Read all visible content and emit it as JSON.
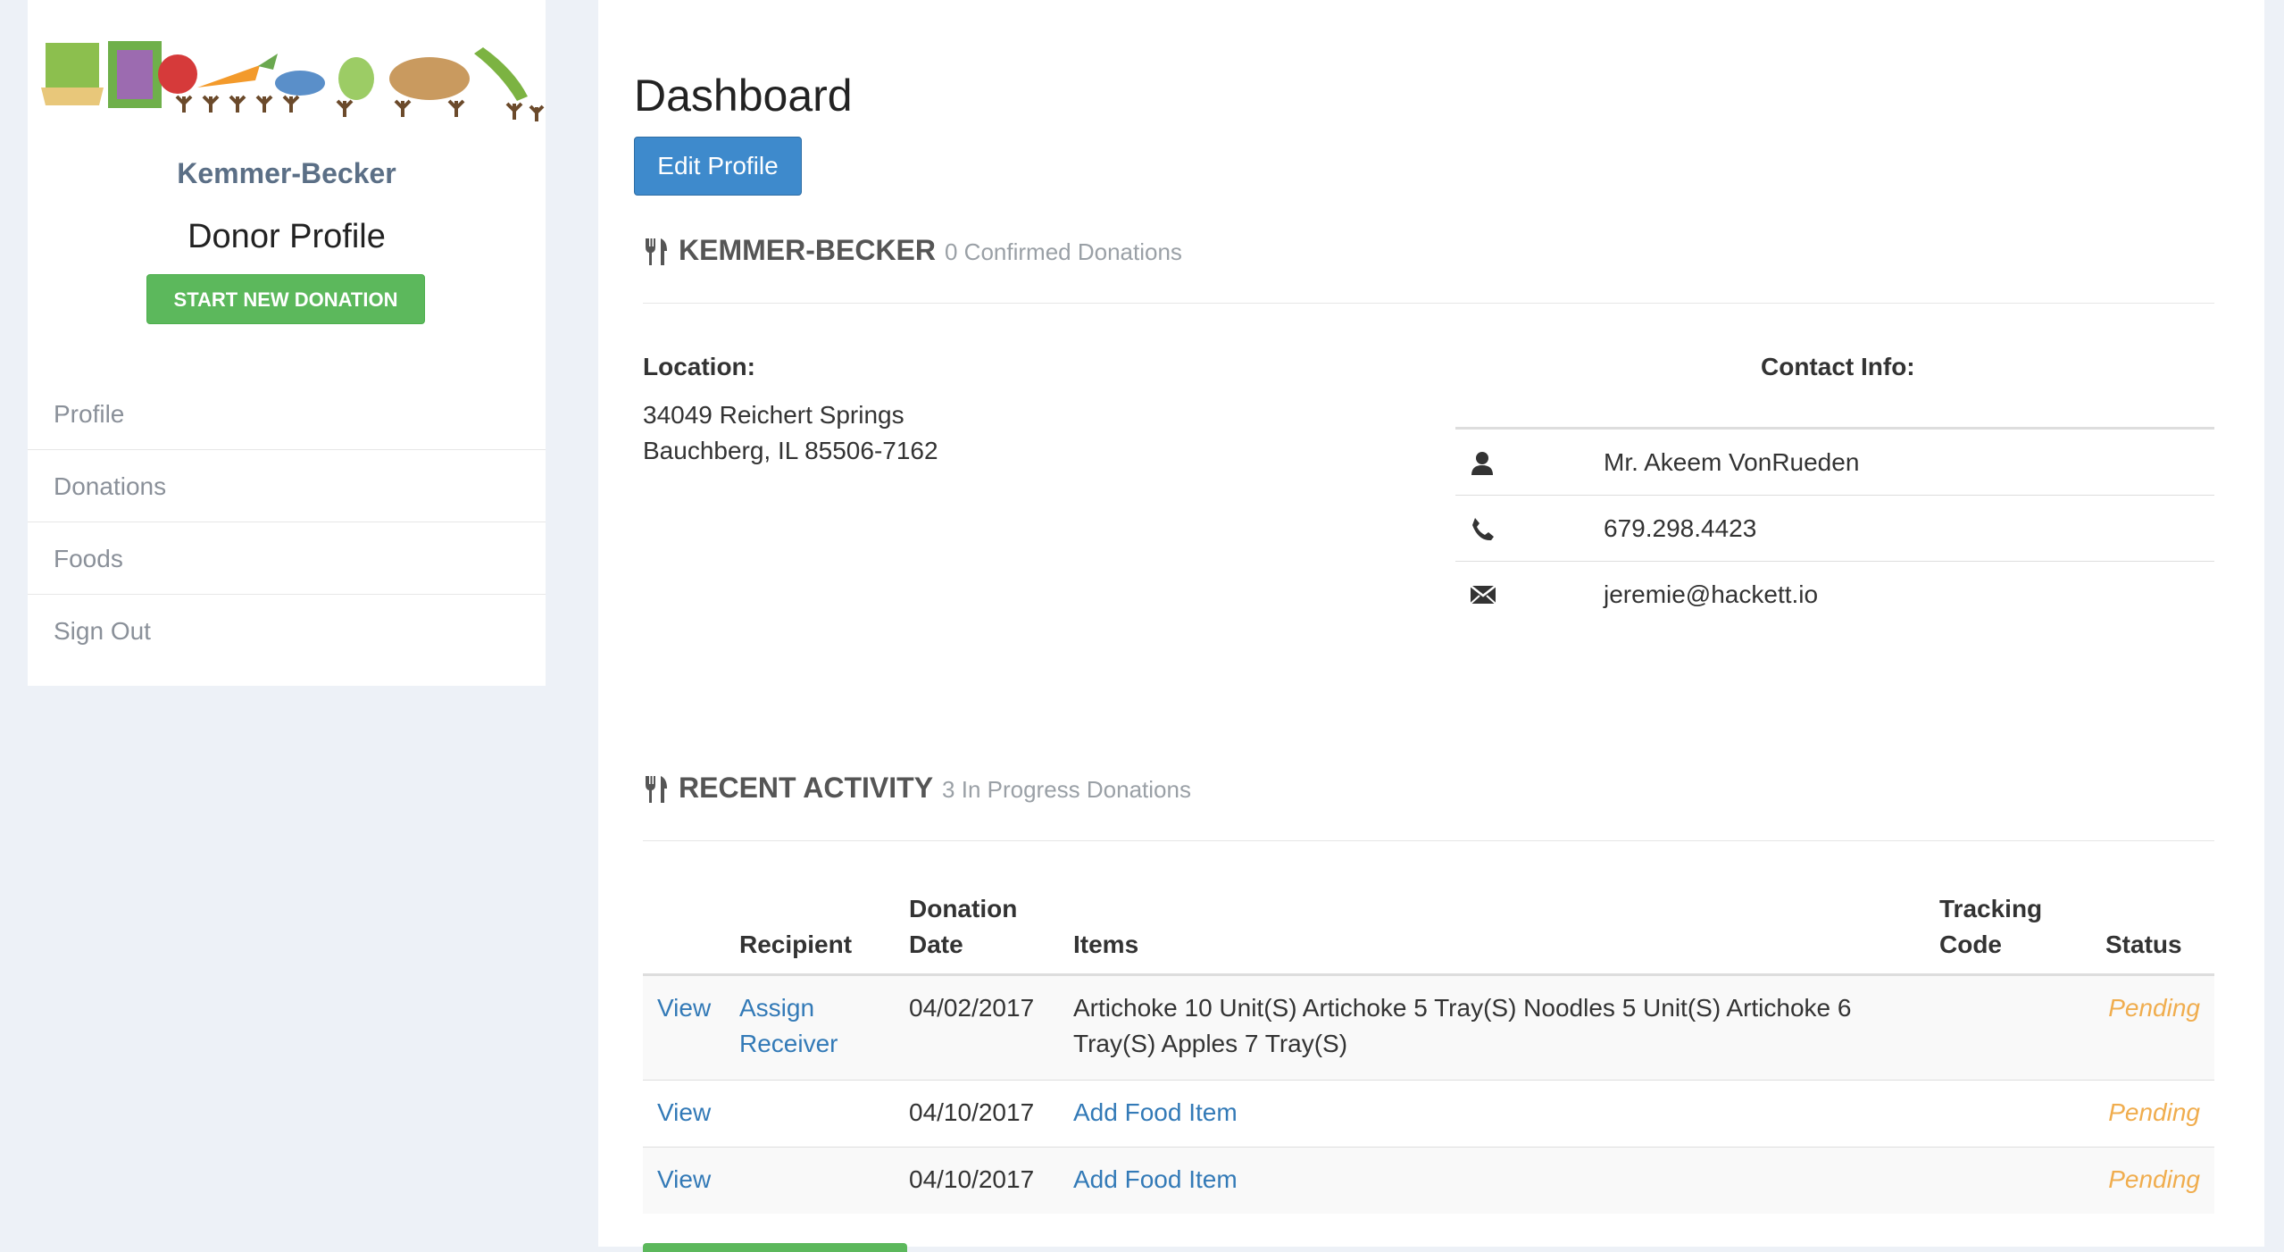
{
  "sidebar": {
    "org_name": "Kemmer-Becker",
    "profile_title": "Donor Profile",
    "start_button": "START NEW DONATION",
    "nav": [
      "Profile",
      "Donations",
      "Foods",
      "Sign Out"
    ]
  },
  "main": {
    "title": "Dashboard",
    "edit_button": "Edit Profile",
    "org_section": {
      "name": "KEMMER-BECKER",
      "sub": "0 Confirmed Donations"
    },
    "location": {
      "label": "Location:",
      "line1": "34049 Reichert Springs",
      "line2": "Bauchberg, IL 85506-7162"
    },
    "contact": {
      "label": "Contact Info:",
      "name": "Mr. Akeem VonRueden",
      "phone": "679.298.4423",
      "email": "jeremie@hackett.io",
      "icons": [
        "user-icon",
        "phone-icon",
        "envelope-icon"
      ]
    },
    "activity_section": {
      "title": "RECENT ACTIVITY",
      "sub": "3 In Progress Donations"
    },
    "table": {
      "headers": {
        "recipient": "Recipient",
        "date_1": "Donation",
        "date_2": "Date",
        "items": "Items",
        "tracking_1": "Tracking",
        "tracking_2": "Code",
        "status": "Status"
      },
      "rows": [
        {
          "view": "View",
          "recipient_1": "Assign",
          "recipient_2": "Receiver",
          "date": "04/02/2017",
          "items_1": "Artichoke 10 Unit(S) Artichoke 5 Tray(S) Noodles 5 Unit(S) Artichoke 6",
          "items_2": "Tray(S) Apples 7 Tray(S)",
          "status": "Pending"
        },
        {
          "view": "View",
          "date": "04/10/2017",
          "items_link": "Add Food Item",
          "status": "Pending"
        },
        {
          "view": "View",
          "date": "04/10/2017",
          "items_link": "Add Food Item",
          "status": "Pending"
        }
      ]
    }
  },
  "colors": {
    "primary": "#3e8acc",
    "success": "#5cb85c",
    "link": "#337ab7",
    "warning": "#f0ad4e",
    "page_bg": "#edf1f7"
  }
}
